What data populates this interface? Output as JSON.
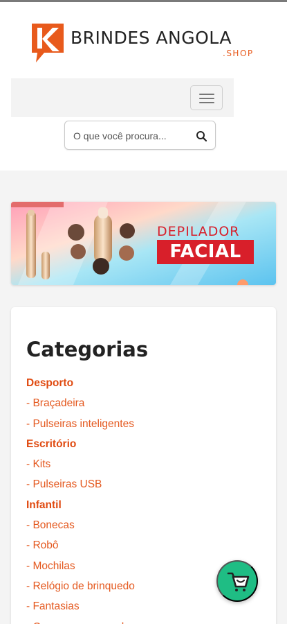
{
  "logo": {
    "name": "BRINDES ANGOLA",
    "suffix": ".SHOP",
    "mark_letter": "K",
    "color": "#e85a1c"
  },
  "navbar": {
    "toggle_icon": "hamburger-icon"
  },
  "search": {
    "placeholder": "O que você procura...",
    "icon": "search-icon"
  },
  "banner": {
    "line1": "DEPILADOR",
    "line2": "FACIAL",
    "accent": "#d81f2a"
  },
  "categories": {
    "title": "Categorias",
    "items": [
      {
        "label": "Desporto",
        "type": "group"
      },
      {
        "label": "- Braçadeira",
        "type": "sub"
      },
      {
        "label": "- Pulseiras inteligentes",
        "type": "sub"
      },
      {
        "label": "Escritório",
        "type": "group"
      },
      {
        "label": "- Kits",
        "type": "sub"
      },
      {
        "label": "- Pulseiras USB",
        "type": "sub"
      },
      {
        "label": "Infantil",
        "type": "group"
      },
      {
        "label": "- Bonecas",
        "type": "sub"
      },
      {
        "label": "- Robô",
        "type": "sub"
      },
      {
        "label": "- Mochilas",
        "type": "sub"
      },
      {
        "label": "- Relógio de brinquedo",
        "type": "sub"
      },
      {
        "label": "- Fantasias",
        "type": "sub"
      },
      {
        "label": "- Carro com comando",
        "type": "sub"
      }
    ]
  },
  "floating_cart": {
    "icon": "shopping-cart-icon",
    "color": "#1fbd84"
  }
}
